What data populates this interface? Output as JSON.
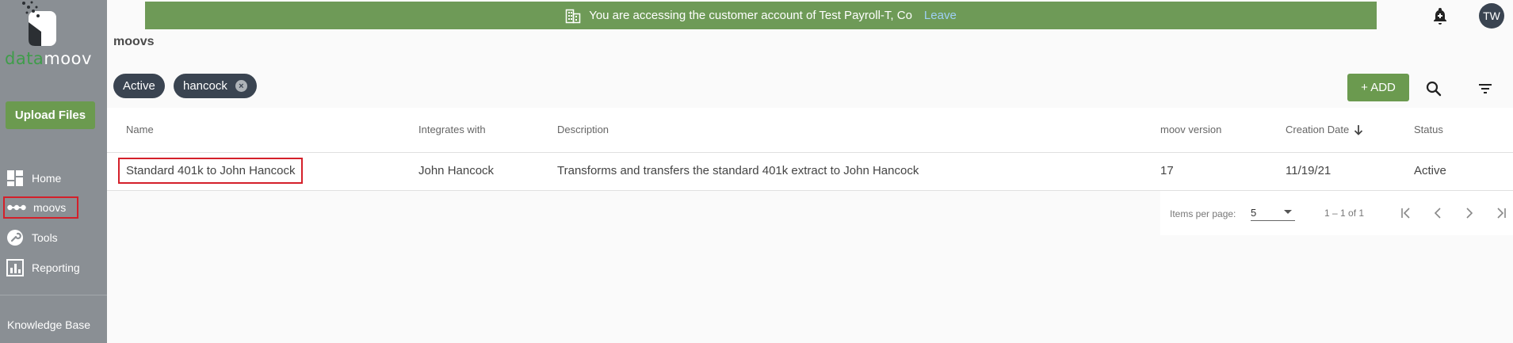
{
  "sidebar": {
    "logo": {
      "green_text": "data",
      "white_text": "moov"
    },
    "upload_label": "Upload Files",
    "items": [
      {
        "label": "Home",
        "icon": "dashboard-icon"
      },
      {
        "label": "moovs",
        "icon": "dots-icon"
      },
      {
        "label": "Tools",
        "icon": "wrench-icon"
      },
      {
        "label": "Reporting",
        "icon": "bar-chart-icon"
      }
    ],
    "knowledge_base": "Knowledge Base"
  },
  "banner": {
    "message": "You are accessing the customer account of Test Payroll-T, Co",
    "leave": "Leave",
    "color": "#6e9a57"
  },
  "header": {
    "avatar_initials": "TW"
  },
  "page": {
    "title": "moovs"
  },
  "filters": {
    "chips": [
      "Active",
      "hancock"
    ]
  },
  "toolbar": {
    "add_label": "+ ADD"
  },
  "table": {
    "columns": [
      "Name",
      "Integrates with",
      "Description",
      "moov version",
      "Creation Date",
      "Status"
    ],
    "rows": [
      {
        "name": "Standard 401k to John Hancock",
        "integrates": "John Hancock",
        "description": "Transforms and transfers the standard 401k extract to John Hancock",
        "version": "17",
        "created": "11/19/21",
        "status": "Active"
      }
    ]
  },
  "pagination": {
    "items_per_page_label": "Items per page:",
    "items_per_page": "5",
    "range": "1 – 1 of 1"
  },
  "colors": {
    "accent_green": "#6b9a4f",
    "sidebar": "#8a8f94",
    "chip": "#3a4451",
    "highlight_red": "#d4202a"
  }
}
